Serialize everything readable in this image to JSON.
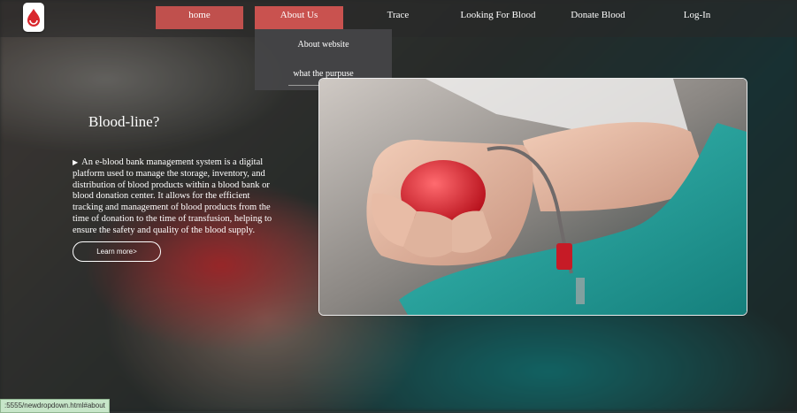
{
  "nav": {
    "home": "home",
    "about": "About Us",
    "trace": "Trace",
    "looking": "Looking For Blood",
    "donate": "Donate Blood",
    "login": "Log-In"
  },
  "dropdown": {
    "items": [
      "About website",
      "what the purpuse"
    ]
  },
  "hero": {
    "title": "Blood-line?",
    "description": "An e-blood bank management system is a digital platform used to manage the storage, inventory, and distribution of blood products within a blood bank or blood donation center. It allows for the efficient tracking and management of blood products from the time of donation to the time of transfusion, helping to ensure the safety and quality of the blood supply.",
    "button": "Learn more>"
  },
  "status_bar": {
    "url": ":5555/newdropdown.html#about"
  },
  "colors": {
    "accent": "#c0504d",
    "teal": "#1aa39d",
    "ball": "#e0323d"
  }
}
